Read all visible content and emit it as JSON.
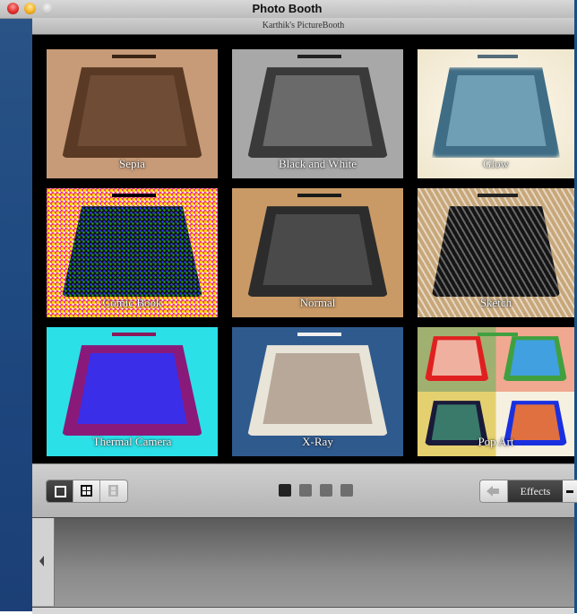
{
  "window": {
    "title": "Photo Booth",
    "ghost_title": "Karthik's Picture Booth",
    "subtitle": "Karthik's PictureBooth"
  },
  "effects_grid": {
    "tiles": [
      {
        "label": "Sepia",
        "bg": "#c79b78",
        "ipad": "#5a3a24",
        "screen": "#6e4c35",
        "top": "#3a2414"
      },
      {
        "label": "Black and White",
        "bg": "#a8a8a8",
        "ipad": "#3a3a3a",
        "screen": "#6a6a6a",
        "top": "#222222"
      },
      {
        "label": "Glow",
        "bg": "#f3efe0",
        "ipad": "#3f6d85",
        "screen": "#6f9fb4",
        "top": "#556b7a"
      },
      {
        "label": "Comic Book",
        "bg": "#ee2a7a",
        "ipad": "#111111",
        "screen": "#1a1a2a",
        "top": "#000000"
      },
      {
        "label": "Normal",
        "bg": "#c99a66",
        "ipad": "#2c2c2c",
        "screen": "#4a4a4a",
        "top": "#1a1a1a"
      },
      {
        "label": "Sketch",
        "bg": "#c7a77a",
        "ipad": "#151515",
        "screen": "#2a2a2a",
        "top": "#222222"
      },
      {
        "label": "Thermal Camera",
        "bg": "#2ce0e8",
        "ipad": "#8a1a7a",
        "screen": "#3a2ee8",
        "top": "#8a1a5a"
      },
      {
        "label": "X-Ray",
        "bg": "#2f5a8e",
        "ipad": "#e8e4d8",
        "screen": "#b8a89a",
        "top": "#f0f0f0"
      },
      {
        "label": "Pop Art",
        "bg": "#f0a890",
        "ipad": "#e02020",
        "screen": "#f0b0a0",
        "top": "#40a040"
      }
    ]
  },
  "toolbar": {
    "view_modes": [
      {
        "name": "single-view",
        "active": true
      },
      {
        "name": "grid-view",
        "active": false
      },
      {
        "name": "filmstrip-view",
        "active": false
      }
    ],
    "pages": [
      {
        "active": true
      },
      {
        "active": false
      },
      {
        "active": false
      },
      {
        "active": false
      }
    ],
    "effects_label": "Effects"
  },
  "colors": {
    "grid_bg": "#000000",
    "toolbar_bg": "#c2c2c2",
    "active_segment": "#2c2c2c",
    "page_dot_active": "#222222",
    "page_dot": "#6e6e6e",
    "desktop": "#1f4a82"
  }
}
